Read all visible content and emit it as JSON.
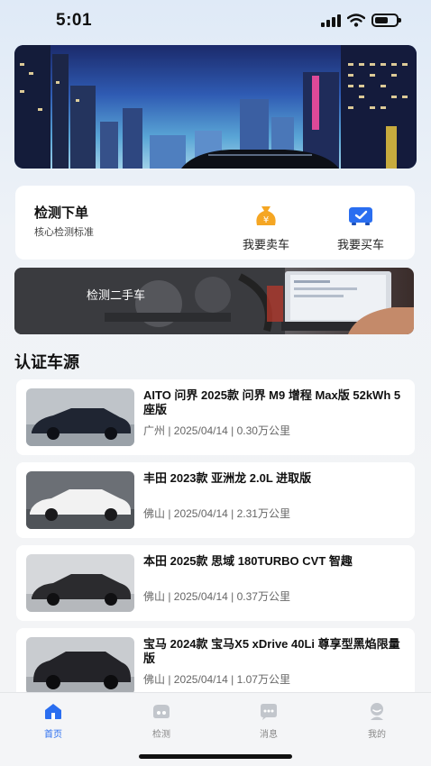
{
  "status_bar": {
    "time": "5:01"
  },
  "order_card": {
    "title": "检测下单",
    "subtitle": "核心检测标准",
    "actions": [
      {
        "label": "我要卖车",
        "icon": "money-bag-icon",
        "color": "#f5a623"
      },
      {
        "label": "我要买车",
        "icon": "car-check-icon",
        "color": "#2a6ef0"
      }
    ]
  },
  "inspect_banner": {
    "title": "检测二手车"
  },
  "section": {
    "title": "认证车源"
  },
  "cars": [
    {
      "title": "AITO 问界 2025款 问界 M9 增程 Max版 52kWh 5座版",
      "meta": "广州 | 2025/04/14 | 0.30万公里",
      "color": "#1f2532"
    },
    {
      "title": "丰田 2023款 亚洲龙 2.0L 进取版",
      "meta": "佛山 | 2025/04/14 | 2.31万公里",
      "color": "#f2f2f2"
    },
    {
      "title": "本田 2025款 思域 180TURBO CVT 智趣",
      "meta": "佛山 | 2025/04/14 | 0.37万公里",
      "color": "#2b2b2e"
    },
    {
      "title": "宝马 2024款 宝马X5 xDrive 40Li 尊享型黑焰限量版",
      "meta": "佛山 | 2025/04/14 | 1.07万公里",
      "color": "#232328"
    }
  ],
  "tabs": [
    {
      "label": "首页",
      "icon": "home-icon",
      "active": true
    },
    {
      "label": "检测",
      "icon": "inspect-icon",
      "active": false
    },
    {
      "label": "消息",
      "icon": "message-icon",
      "active": false
    },
    {
      "label": "我的",
      "icon": "profile-icon",
      "active": false
    }
  ],
  "colors": {
    "accent": "#2a6ef0",
    "inactive": "#c2c6cc"
  }
}
